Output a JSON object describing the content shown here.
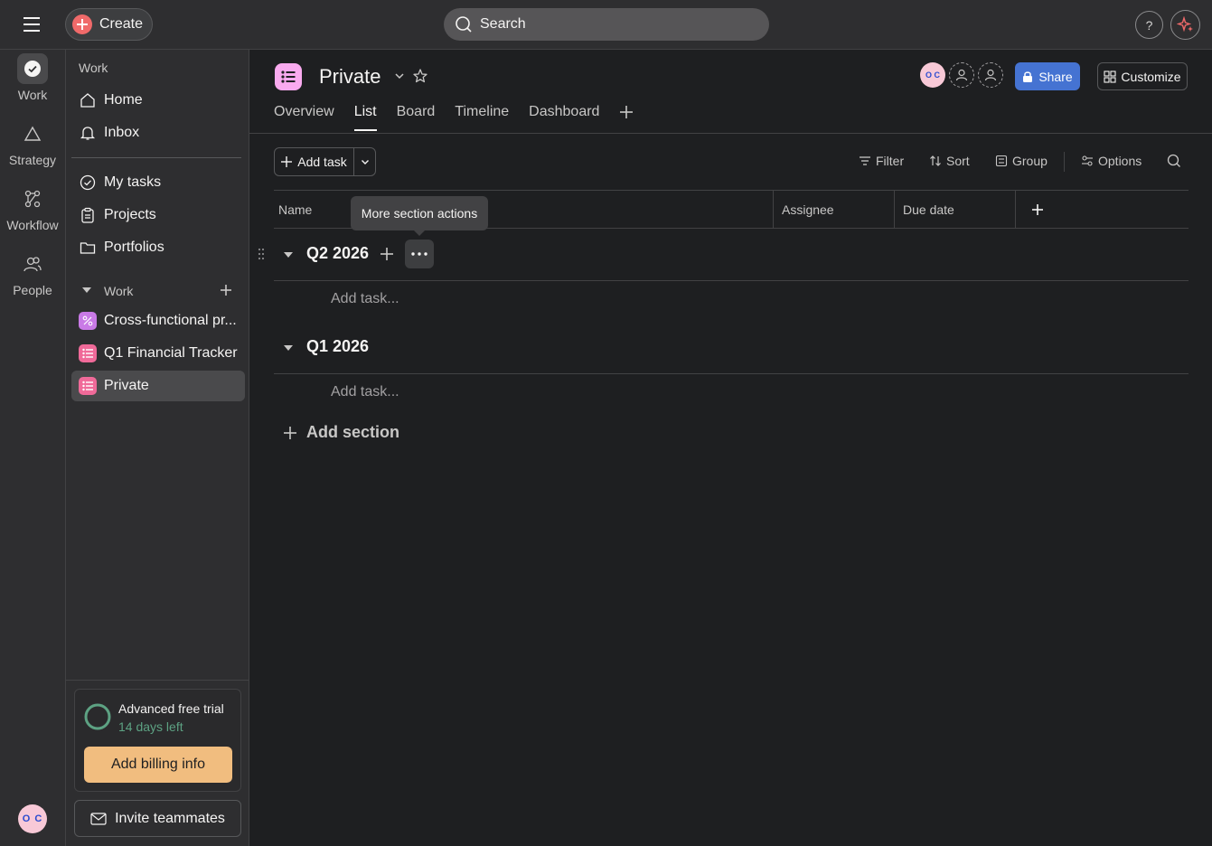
{
  "topbar": {
    "create_label": "Create",
    "search_placeholder": "Search",
    "help_label": "?"
  },
  "rail": {
    "items": [
      {
        "label": "Work",
        "icon": "check-circle-icon"
      },
      {
        "label": "Strategy",
        "icon": "triangle-icon"
      },
      {
        "label": "Workflow",
        "icon": "workflow-icon"
      },
      {
        "label": "People",
        "icon": "people-icon"
      }
    ],
    "avatar_initials": "O C"
  },
  "sidebar": {
    "section_work": "Work",
    "nav": [
      {
        "label": "Home",
        "icon": "home-icon"
      },
      {
        "label": "Inbox",
        "icon": "bell-icon"
      }
    ],
    "nav2": [
      {
        "label": "My tasks",
        "icon": "check-circle-icon"
      },
      {
        "label": "Projects",
        "icon": "clipboard-icon"
      },
      {
        "label": "Portfolios",
        "icon": "folder-icon"
      }
    ],
    "team_heading": "Work",
    "projects": [
      {
        "label": "Cross-functional pr...",
        "color": "#c97ae6"
      },
      {
        "label": "Q1 Financial Tracker",
        "color": "#f06a99"
      },
      {
        "label": "Private",
        "color": "#f06a99",
        "active": true
      }
    ],
    "trial": {
      "title": "Advanced free trial",
      "days_left": "14 days left",
      "billing_button": "Add billing info"
    },
    "invite_button": "Invite teammates"
  },
  "project": {
    "title": "Private",
    "icon_color": "#f9aaef",
    "tabs": [
      "Overview",
      "List",
      "Board",
      "Timeline",
      "Dashboard"
    ],
    "active_tab": "List",
    "member_initials": "O C",
    "share_label": "Share",
    "customize_label": "Customize"
  },
  "toolbar": {
    "add_task_label": "Add task",
    "filter_label": "Filter",
    "sort_label": "Sort",
    "group_label": "Group",
    "options_label": "Options"
  },
  "table": {
    "columns": [
      "Name",
      "Assignee",
      "Due date"
    ],
    "sections": [
      {
        "title": "Q2 2026",
        "add_task_placeholder": "Add task..."
      },
      {
        "title": "Q1 2026",
        "add_task_placeholder": "Add task..."
      }
    ],
    "tooltip": "More section actions",
    "add_section_label": "Add section"
  },
  "colors": {
    "accent": "#4573d2",
    "create_plus": "#f06a6a",
    "billing": "#f1bd7f",
    "trial_ring": "#5da283"
  }
}
